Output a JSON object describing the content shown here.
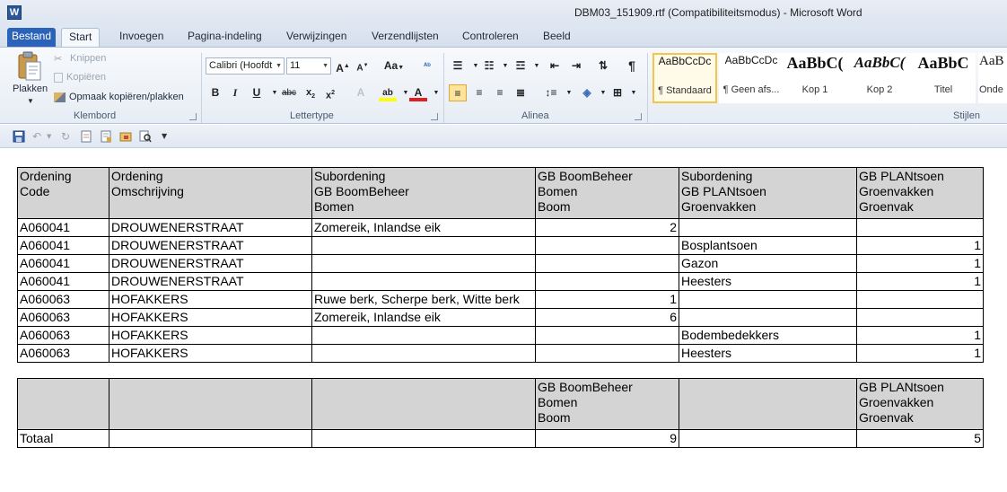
{
  "window": {
    "title": "DBM03_151909.rtf (Compatibiliteitsmodus)  -  Microsoft Word",
    "app_icon_letter": "W"
  },
  "tabs": [
    {
      "label": "Bestand"
    },
    {
      "label": "Start"
    },
    {
      "label": "Invoegen"
    },
    {
      "label": "Pagina-indeling"
    },
    {
      "label": "Verwijzingen"
    },
    {
      "label": "Verzendlijsten"
    },
    {
      "label": "Controleren"
    },
    {
      "label": "Beeld"
    }
  ],
  "ribbon": {
    "klembord": {
      "label": "Klembord",
      "paste": "Plakken",
      "cut": "Knippen",
      "copy": "Kopiëren",
      "format_painter": "Opmaak kopiëren/plakken"
    },
    "lettertype": {
      "label": "Lettertype",
      "font_name": "Calibri (Hoofdt",
      "font_size": "11"
    },
    "alinea": {
      "label": "Alinea"
    },
    "stijlen": {
      "label": "Stijlen",
      "styles": [
        {
          "preview": "AaBbCcDc",
          "name": "¶ Standaard"
        },
        {
          "preview": "AaBbCcDc",
          "name": "¶ Geen afs..."
        },
        {
          "preview": "AaBbC(",
          "name": "Kop 1"
        },
        {
          "preview": "AaBbC(",
          "name": "Kop 2"
        },
        {
          "preview": "AaBbC",
          "name": "Titel"
        },
        {
          "preview": "AaB",
          "name": "Onde"
        }
      ]
    }
  },
  "table1": {
    "headers": [
      [
        "Ordening",
        "Code"
      ],
      [
        "Ordening",
        "Omschrijving"
      ],
      [
        "Subordening",
        "GB BoomBeheer",
        "Bomen"
      ],
      [
        "GB BoomBeheer",
        "Bomen",
        "Boom"
      ],
      [
        "Subordening",
        "GB PLANtsoen",
        "Groenvakken"
      ],
      [
        "GB PLANtsoen",
        "Groenvakken",
        "Groenvak"
      ]
    ],
    "rows": [
      [
        "A060041",
        "DROUWENERSTRAAT",
        "Zomereik, Inlandse eik",
        "2",
        "",
        ""
      ],
      [
        "A060041",
        "DROUWENERSTRAAT",
        "",
        "",
        "Bosplantsoen",
        "1"
      ],
      [
        "A060041",
        "DROUWENERSTRAAT",
        "",
        "",
        "Gazon",
        "1"
      ],
      [
        "A060041",
        "DROUWENERSTRAAT",
        "",
        "",
        "Heesters",
        "1"
      ],
      [
        "A060063",
        "HOFAKKERS",
        "Ruwe berk, Scherpe berk, Witte berk",
        "1",
        "",
        ""
      ],
      [
        "A060063",
        "HOFAKKERS",
        "Zomereik, Inlandse eik",
        "6",
        "",
        ""
      ],
      [
        "A060063",
        "HOFAKKERS",
        "",
        "",
        "Bodembedekkers",
        "1"
      ],
      [
        "A060063",
        "HOFAKKERS",
        "",
        "",
        "Heesters",
        "1"
      ]
    ]
  },
  "table2": {
    "headers": [
      [],
      [],
      [],
      [
        "GB BoomBeheer",
        "Bomen",
        "Boom"
      ],
      [],
      [
        "GB PLANtsoen",
        "Groenvakken",
        "Groenvak"
      ]
    ],
    "rows": [
      [
        "Totaal",
        "",
        "",
        "9",
        "",
        "5"
      ]
    ]
  }
}
